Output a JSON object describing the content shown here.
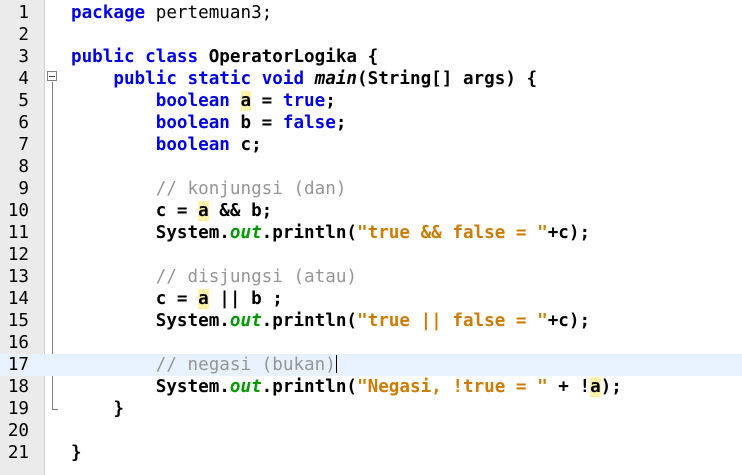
{
  "editor": {
    "line_numbers": [
      "1",
      "2",
      "3",
      "4",
      "5",
      "6",
      "7",
      "8",
      "9",
      "10",
      "11",
      "12",
      "13",
      "14",
      "15",
      "16",
      "17",
      "18",
      "19",
      "20",
      "21"
    ],
    "current_line": 17,
    "lines": [
      [
        {
          "t": "package",
          "c": "kw"
        },
        {
          "t": " pertemuan3;",
          "c": ""
        }
      ],
      [],
      [
        {
          "t": "public",
          "c": "kw"
        },
        {
          "t": " ",
          "c": ""
        },
        {
          "t": "class",
          "c": "kw"
        },
        {
          "t": " OperatorLogika {",
          "c": "op"
        }
      ],
      [
        {
          "t": "    ",
          "c": ""
        },
        {
          "t": "public",
          "c": "kw"
        },
        {
          "t": " ",
          "c": ""
        },
        {
          "t": "static",
          "c": "kw"
        },
        {
          "t": " ",
          "c": ""
        },
        {
          "t": "void",
          "c": "kw"
        },
        {
          "t": " ",
          "c": ""
        },
        {
          "t": "main",
          "c": "mth"
        },
        {
          "t": "(String[] args) {",
          "c": "op"
        }
      ],
      [
        {
          "t": "        ",
          "c": ""
        },
        {
          "t": "boolean",
          "c": "kw"
        },
        {
          "t": " ",
          "c": ""
        },
        {
          "t": "a",
          "c": "mark op"
        },
        {
          "t": " = ",
          "c": "op"
        },
        {
          "t": "true",
          "c": "kw"
        },
        {
          "t": ";",
          "c": "op"
        }
      ],
      [
        {
          "t": "        ",
          "c": ""
        },
        {
          "t": "boolean",
          "c": "kw"
        },
        {
          "t": " b = ",
          "c": "op"
        },
        {
          "t": "false",
          "c": "kw"
        },
        {
          "t": ";",
          "c": "op"
        }
      ],
      [
        {
          "t": "        ",
          "c": ""
        },
        {
          "t": "boolean",
          "c": "kw"
        },
        {
          "t": " c;",
          "c": "op"
        }
      ],
      [],
      [
        {
          "t": "        ",
          "c": ""
        },
        {
          "t": "// konjungsi (dan)",
          "c": "cmt"
        }
      ],
      [
        {
          "t": "        c = ",
          "c": "op"
        },
        {
          "t": "a",
          "c": "mark op"
        },
        {
          "t": " && b;",
          "c": "op"
        }
      ],
      [
        {
          "t": "        System.",
          "c": "op"
        },
        {
          "t": "out",
          "c": "fld"
        },
        {
          "t": ".println(",
          "c": "op"
        },
        {
          "t": "\"true && false = \"",
          "c": "str"
        },
        {
          "t": "+c);",
          "c": "op"
        }
      ],
      [],
      [
        {
          "t": "        ",
          "c": ""
        },
        {
          "t": "// disjungsi (atau)",
          "c": "cmt"
        }
      ],
      [
        {
          "t": "        c = ",
          "c": "op"
        },
        {
          "t": "a",
          "c": "mark op"
        },
        {
          "t": " || b ;",
          "c": "op"
        }
      ],
      [
        {
          "t": "        System.",
          "c": "op"
        },
        {
          "t": "out",
          "c": "fld"
        },
        {
          "t": ".println(",
          "c": "op"
        },
        {
          "t": "\"true || false = \"",
          "c": "str"
        },
        {
          "t": "+c);",
          "c": "op"
        }
      ],
      [],
      [
        {
          "t": "        ",
          "c": ""
        },
        {
          "t": "// negasi (bukan)",
          "c": "cmt"
        },
        {
          "t": "",
          "c": "caret"
        }
      ],
      [
        {
          "t": "        System.",
          "c": "op"
        },
        {
          "t": "out",
          "c": "fld"
        },
        {
          "t": ".println(",
          "c": "op"
        },
        {
          "t": "\"Negasi, !true = \"",
          "c": "str"
        },
        {
          "t": " + !",
          "c": "op"
        },
        {
          "t": "a",
          "c": "mark op"
        },
        {
          "t": ");",
          "c": "op"
        }
      ],
      [
        {
          "t": "    }",
          "c": "op"
        }
      ],
      [],
      [
        {
          "t": "}",
          "c": "op"
        }
      ]
    ]
  }
}
